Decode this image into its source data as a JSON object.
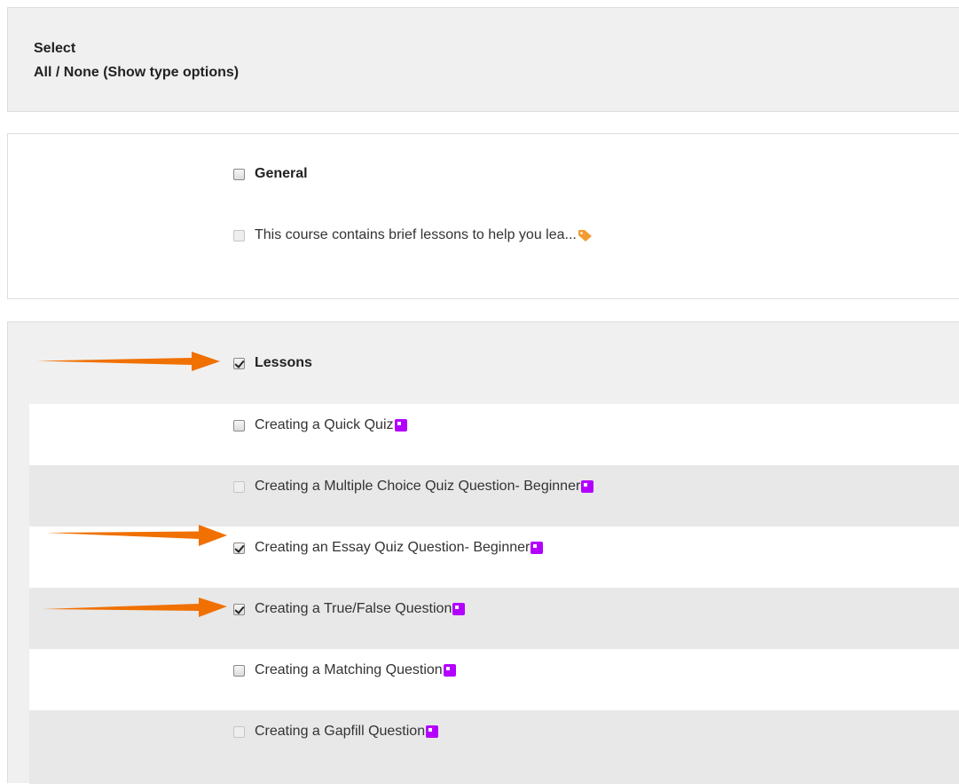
{
  "select_section": {
    "title": "Select",
    "options": "All / None (Show type options)"
  },
  "general_section": {
    "header_label": "General",
    "header_checked": false,
    "items": [
      {
        "label": "This course contains brief lessons to help you lea...",
        "checked": false,
        "disabled": true,
        "icon": "tag-icon"
      }
    ]
  },
  "lessons_section": {
    "header_label": "Lessons",
    "header_checked": true,
    "items": [
      {
        "label": "Creating a Quick Quiz",
        "checked": false,
        "disabled": false,
        "icon": "lesson-icon"
      },
      {
        "label": "Creating a Multiple Choice Quiz Question- Beginner",
        "checked": false,
        "disabled": true,
        "icon": "lesson-icon"
      },
      {
        "label": "Creating an Essay Quiz Question- Beginner",
        "checked": true,
        "disabled": false,
        "icon": "lesson-icon"
      },
      {
        "label": "Creating a True/False Question",
        "checked": true,
        "disabled": false,
        "icon": "lesson-icon"
      },
      {
        "label": "Creating a Matching Question",
        "checked": false,
        "disabled": false,
        "icon": "lesson-icon"
      },
      {
        "label": "Creating a Gapfill Question",
        "checked": false,
        "disabled": true,
        "icon": "lesson-icon"
      }
    ]
  },
  "colors": {
    "arrow": "#f07000",
    "lesson_icon": "#b300ff",
    "tag_icon": "#f39c33",
    "panel_grey": "#f0f0f0",
    "row_grey": "#e8e8e8"
  }
}
